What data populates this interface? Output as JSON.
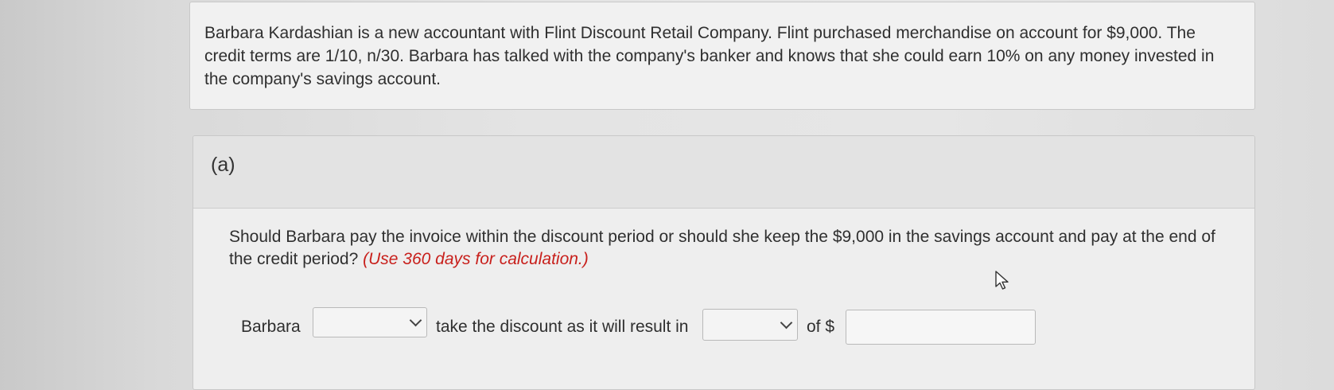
{
  "problem": {
    "text": "Barbara Kardashian is a new accountant with Flint Discount Retail Company. Flint purchased merchandise on account for $9,000. The credit terms are 1/10, n/30. Barbara has talked with the company's banker and knows that she could earn 10% on any money invested in the company's savings account."
  },
  "part": {
    "label": "(a)",
    "question": "Should Barbara pay the invoice within the discount period or should she keep the $9,000 in the savings account and pay at the end of the credit period?",
    "instruction": "(Use 360 days for calculation.)"
  },
  "answer": {
    "prefix": "Barbara",
    "middle": "take the discount as it will result in",
    "suffix": "of $",
    "dropdown1_value": "",
    "dropdown2_value": "",
    "amount_value": ""
  },
  "icons": {
    "dropdown_arrow": "chevron-down-icon",
    "cursor": "mouse-pointer-icon"
  }
}
